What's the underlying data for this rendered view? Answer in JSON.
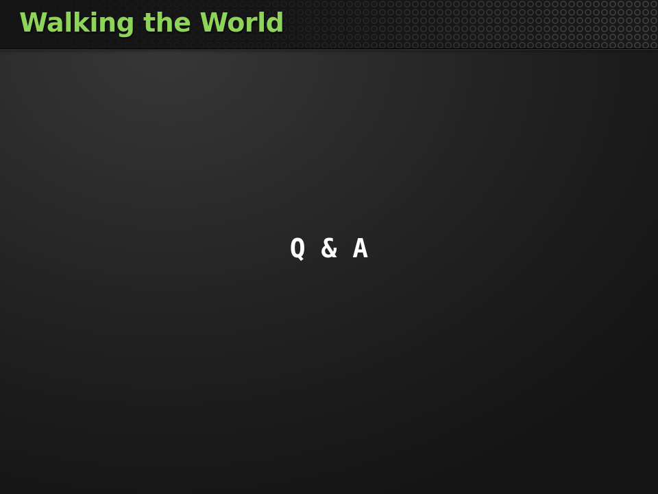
{
  "slide": {
    "title": "Walking the World",
    "body": "Q & A"
  },
  "colors": {
    "title_text": "#8fd45a",
    "body_text": "#ffffff",
    "background": "#2a2a2a",
    "header_band": "#1a1a1a"
  }
}
